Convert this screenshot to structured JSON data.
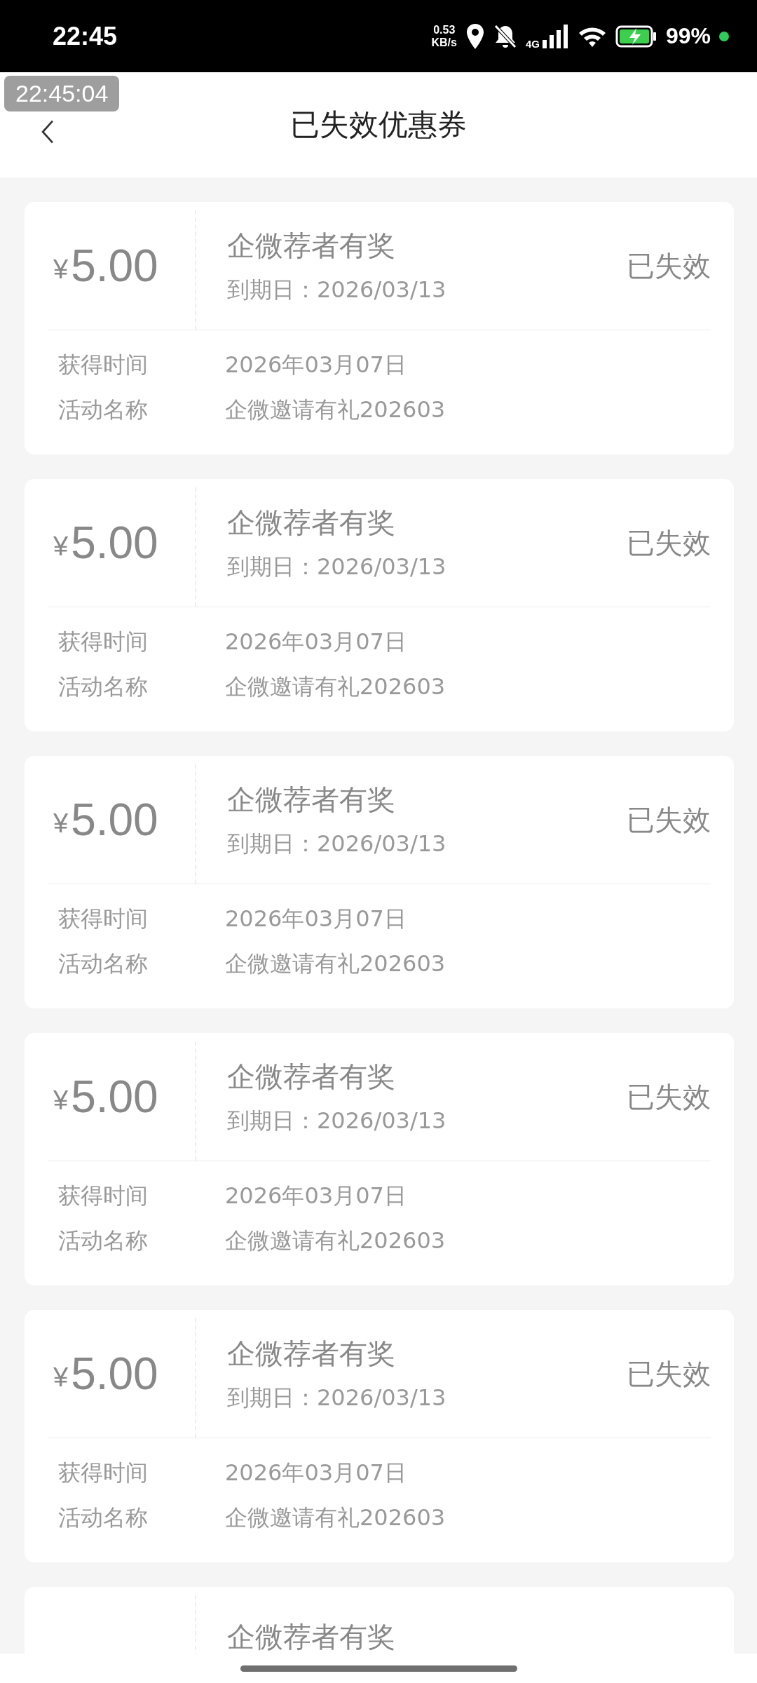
{
  "status_bar": {
    "time": "22:45",
    "net_speed_value": "0.53",
    "net_speed_unit": "KB/s",
    "network": "4G",
    "battery": "99%"
  },
  "overlay_timestamp": "22:45:04",
  "header": {
    "title": "已失效优惠券"
  },
  "coupons": [
    {
      "kind": "full",
      "currency": "¥",
      "amount": "5.00",
      "title": "企微荐者有奖",
      "expiry_label": "到期日：",
      "expiry": "2026/03/13",
      "status": "已失效",
      "rows": [
        {
          "label": "获得时间",
          "value": "2026年03月07日"
        },
        {
          "label": "活动名称",
          "value": "企微邀请有礼202603"
        }
      ]
    },
    {
      "kind": "full",
      "currency": "¥",
      "amount": "5.00",
      "title": "企微荐者有奖",
      "expiry_label": "到期日：",
      "expiry": "2026/03/13",
      "status": "已失效",
      "rows": [
        {
          "label": "获得时间",
          "value": "2026年03月07日"
        },
        {
          "label": "活动名称",
          "value": "企微邀请有礼202603"
        }
      ]
    },
    {
      "kind": "full",
      "currency": "¥",
      "amount": "5.00",
      "title": "企微荐者有奖",
      "expiry_label": "到期日：",
      "expiry": "2026/03/13",
      "status": "已失效",
      "rows": [
        {
          "label": "获得时间",
          "value": "2026年03月07日"
        },
        {
          "label": "活动名称",
          "value": "企微邀请有礼202603"
        }
      ]
    },
    {
      "kind": "full",
      "currency": "¥",
      "amount": "5.00",
      "title": "企微荐者有奖",
      "expiry_label": "到期日：",
      "expiry": "2026/03/13",
      "status": "已失效",
      "rows": [
        {
          "label": "获得时间",
          "value": "2026年03月07日"
        },
        {
          "label": "活动名称",
          "value": "企微邀请有礼202603"
        }
      ]
    },
    {
      "kind": "full",
      "currency": "¥",
      "amount": "5.00",
      "title": "企微荐者有奖",
      "expiry_label": "到期日：",
      "expiry": "2026/03/13",
      "status": "已失效",
      "rows": [
        {
          "label": "获得时间",
          "value": "2026年03月07日"
        },
        {
          "label": "活动名称",
          "value": "企微邀请有礼202603"
        }
      ]
    },
    {
      "kind": "partial",
      "title": "企微荐者有奖"
    }
  ]
}
